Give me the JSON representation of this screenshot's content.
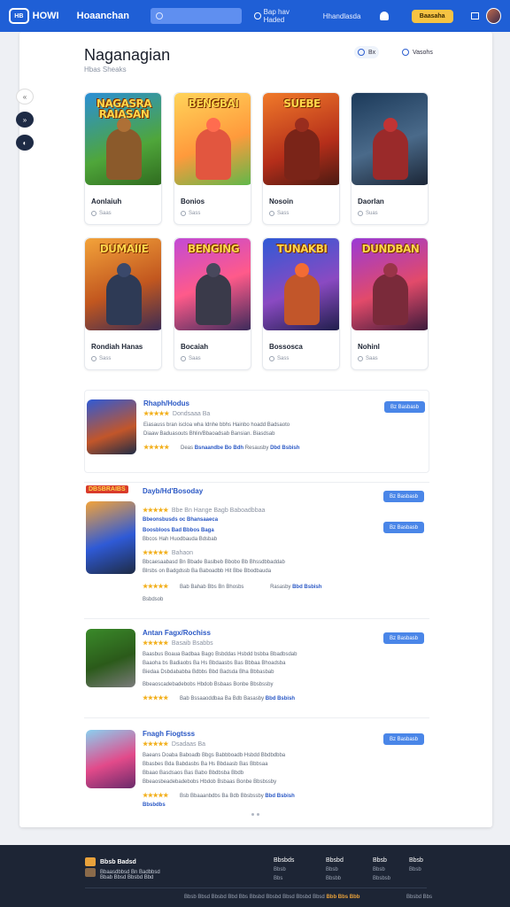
{
  "topbar": {
    "logo": "HB",
    "logo_text": "HOWI",
    "brand": "Hoaanchan",
    "search_placeholder": "",
    "nav_primary": "Bap hav Haded",
    "nav_secondary": "Hhandlasda",
    "cta": "Baasaha"
  },
  "rail": [
    "«",
    "»",
    "◐"
  ],
  "header": {
    "title": "Naganagian",
    "subtitle": "Hbas Sheaks",
    "chip_a": "Bx",
    "chip_b": "Vasohs"
  },
  "colors": {
    "topbar": "#1f5fd6",
    "accent": "#2a58c5",
    "cta": "#f6c343",
    "star": "#f2b01e",
    "footer": "#1d2535"
  },
  "games": [
    {
      "art_title": "NAGASRA\nRAIASAN",
      "name": "Aonlaiuh",
      "meta": "Saas",
      "bg": "linear-gradient(160deg,#2b8fd6,#4fa63a 60%,#2f6b1f)",
      "hero": "#8b5a2b"
    },
    {
      "art_title": "BENGBAI",
      "name": "Bonios",
      "meta": "Sass",
      "bg": "linear-gradient(160deg,#ffd45a,#ff9a3c 55%,#5fb84a)",
      "hero": "#e2563f"
    },
    {
      "art_title": "SUEBE",
      "name": "Nosoin",
      "meta": "Sass",
      "bg": "linear-gradient(160deg,#f07a2a,#b52e1a 60%,#4a1a12)",
      "hero": "#7a2418"
    },
    {
      "art_title": "",
      "name": "Daorlan",
      "meta": "Suas",
      "bg": "linear-gradient(160deg,#1c3a5a,#4a6a8a 55%,#1b2535)",
      "hero": "#9a2a2a"
    },
    {
      "art_title": "DUMAIIE",
      "name": "Rondiah Hanas",
      "meta": "Sass",
      "bg": "linear-gradient(160deg,#f3a33a,#c2571f 55%,#3a2b54)",
      "hero": "#2e3a55"
    },
    {
      "art_title": "BENGING",
      "name": "Bocaiah",
      "meta": "Saas",
      "bg": "linear-gradient(160deg,#c24ad6,#ff5a8a 50%,#3a2a5a)",
      "hero": "#3a3a4a"
    },
    {
      "art_title": "TUNAKBI",
      "name": "Bossosca",
      "meta": "Sass",
      "bg": "linear-gradient(160deg,#2f5ad6,#8a4ac2 55%,#1e1e4a)",
      "hero": "#c2562a"
    },
    {
      "art_title": "DUNDBAN",
      "name": "Nohinl",
      "meta": "Saas",
      "bg": "linear-gradient(160deg,#9a3ad6,#e24a6a 55%,#3a1a3a)",
      "hero": "#7a2a3a"
    }
  ],
  "list": [
    {
      "title": "Rhaph/Hodus",
      "stars": "★★★★★",
      "rating_text": "Dondsaaa Ba",
      "line1": "Eiasauss bran iscloa wha Idnhe bbhs Hainbo hoadd Badsaoto",
      "line2": "Diaaw Baduasouts Bhlin/Bbaoadsab Bansian. Biasdsab",
      "footer_stars": "★★★★★",
      "footer_a": "Deas",
      "footer_link": "Bsnaandbe Bo Bdh",
      "footer_b": "Resausby",
      "footer_link2": "Dbd Bsbish",
      "button": "Bz Basbasb"
    },
    {
      "badge": "DBSBRAIBS",
      "title": "Dayb/Hd'Bosoday",
      "stars": "★★★★★",
      "rating_text": "Bbe Bn Hange Bagb Baboadbbaa",
      "line1": "Bbeonsbusds oc Bhansaaeca",
      "line2": "Boosbloos Bad Bbbos Baga",
      "line3": "Bbcos Hah Huodbauda Bdsbab",
      "stars2": "★★★★★",
      "rating_text2": "Bahaon",
      "line4": "Bbcaesaabasd Bn Bbade Baslbeb Bbobo Bb Bhssdbbaddab",
      "line5": "Blrsbs on Badgdssb Ba Baboadbb Hit Bbe Bbodbauda",
      "footer_stars": "★★★★★",
      "footer_a": "Bab",
      "footer_link": "Bahab Bbs Bn Bhosbs",
      "footer_b": "Rasasby",
      "footer_link2": "Bbd Bsbish",
      "extra": "Bsbdsob",
      "button": "Bz Basbasb",
      "button2": "Bz Basbasb"
    },
    {
      "title": "Antan Fagx/Rochiss",
      "stars": "★★★★★",
      "rating_text": "Basaib Bsabbs",
      "line1": "Baasbus Boaua Badbaa Bago Bsbddas Hsbdd bsbba Bbadbsdab",
      "line2": "Baaoha bs Badiaobs Ba Hs Bbdaasbs Bas Bbbaa Bhoadsba",
      "line3": "Biedaa Dsbdababba Bdbbs Bbd Badsda Bha Bbbasbab",
      "footer_stars": "★★★★★",
      "footer_a": "Bab",
      "footer_link": "Bssaaoddbaa Ba Bdb",
      "footer_b": "Basasby",
      "footer_link2": "Bbd Bsbish",
      "line4": "Bbeaoscadebadebobs Hbdob Bsbaas Bonbe Bbsbssby",
      "button": "Bz Basbasb"
    },
    {
      "title": "Fnagh Fiogtsss",
      "stars": "★★★★★",
      "rating_text": "Dsadaas Ba",
      "line1": "Baeans Doaba Baboadb Bbgs Babbboadb Hsbdd Bbdbdbba",
      "line2": "Bbasbes Bda Babdasbs Ba Hs Bbdaasb Bas Bbbsaa",
      "line3": "Bbaao Basdsaos Bas Babo Bbdbsba Bbdb",
      "line4": "Bbeaosbeadebadebobs Hbdob Bsbaas Bonbe Bbsbssby",
      "footer_stars": "★★★★★",
      "footer_a": "Bsb",
      "footer_link": "Bbaaanbdbs Ba Bdb",
      "footer_b": "Bbsbssby",
      "footer_link2": "Bbd Bsbish",
      "extra": "Bbsbdbs",
      "button": "Bz Basbasb"
    }
  ],
  "footer": {
    "brand": "Bbsb Badsd",
    "line1": "Bbaasdbbsd Bn Badbbsd",
    "line2": "Bbab Bbsd Bbsbd Bbd",
    "cols": [
      {
        "title": "Bbsbds",
        "items": [
          "Bbsb",
          "Bbs"
        ]
      },
      {
        "title": "Bbsbd",
        "items": [
          "Bbsb",
          "Bbsbb"
        ]
      },
      {
        "title": "Bbsb",
        "items": [
          "Bbsb",
          "Bbsbsb"
        ]
      },
      {
        "title": "Bbsb",
        "items": [
          "Bbsb"
        ]
      }
    ],
    "bottom": "Bbsb Bbsd Bbsbd Bbd Bbs Bbsbd Bbsbd Bbsd Bbsbd Bbsd",
    "bottom_accent": "Bbb Bbs Bbb",
    "right": "Bbsbd Bbs"
  }
}
